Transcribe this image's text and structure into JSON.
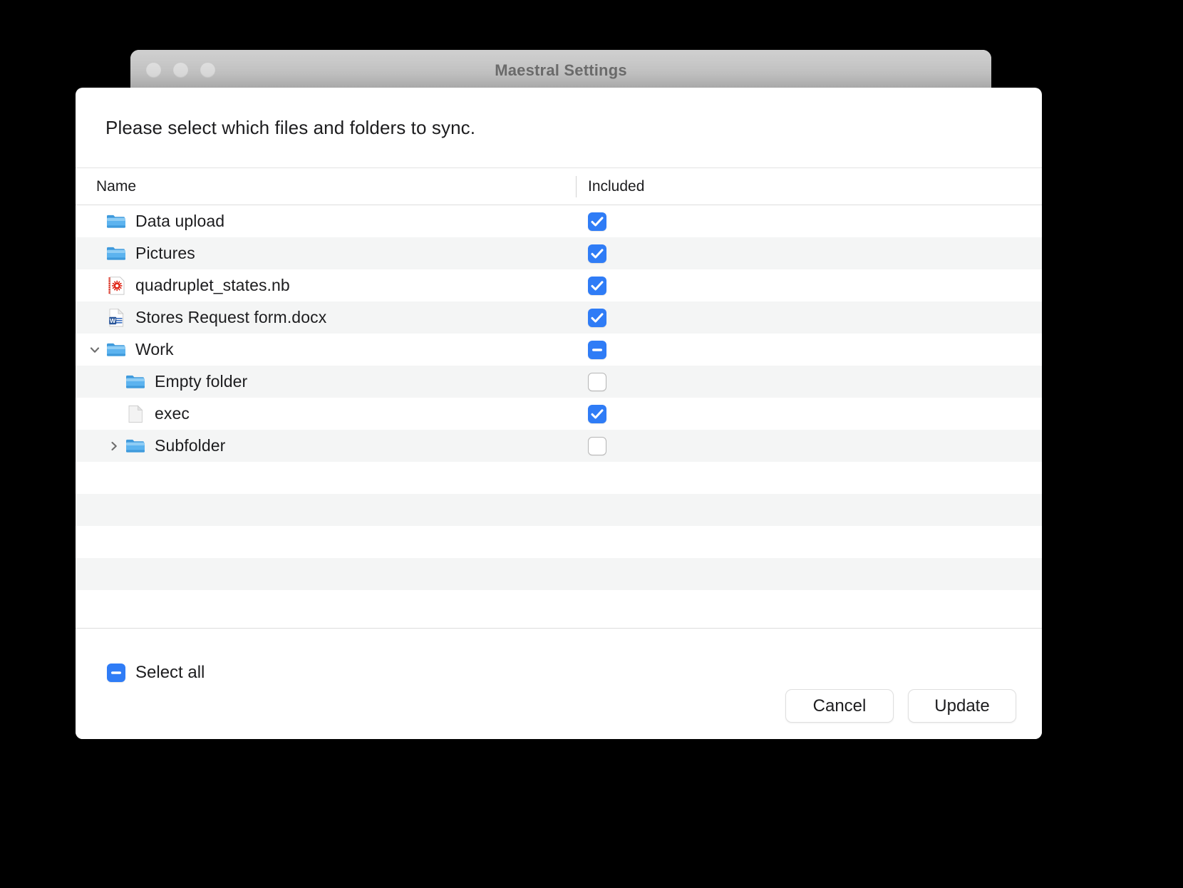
{
  "window": {
    "title": "Maestral Settings",
    "traffic_lights": [
      "close",
      "minimize",
      "zoom"
    ]
  },
  "dialog": {
    "prompt": "Please select which files and folders to sync.",
    "columns": {
      "name": "Name",
      "included": "Included"
    },
    "rows": [
      {
        "label": "Data upload",
        "icon": "folder-icon",
        "level": 0,
        "disclosure": "none",
        "checked": "on"
      },
      {
        "label": "Pictures",
        "icon": "folder-icon",
        "level": 0,
        "disclosure": "none",
        "checked": "on"
      },
      {
        "label": "quadruplet_states.nb",
        "icon": "mathematica-notebook-icon",
        "level": 0,
        "disclosure": "none",
        "checked": "on"
      },
      {
        "label": "Stores Request form.docx",
        "icon": "word-document-icon",
        "level": 0,
        "disclosure": "none",
        "checked": "on"
      },
      {
        "label": "Work",
        "icon": "folder-icon",
        "level": 0,
        "disclosure": "expanded",
        "checked": "mixed"
      },
      {
        "label": "Empty folder",
        "icon": "folder-icon",
        "level": 1,
        "disclosure": "none",
        "checked": "off"
      },
      {
        "label": "exec",
        "icon": "generic-file-icon",
        "level": 1,
        "disclosure": "none",
        "checked": "on"
      },
      {
        "label": "Subfolder",
        "icon": "folder-icon",
        "level": 1,
        "disclosure": "collapsed",
        "checked": "off"
      }
    ],
    "empty_row_count": 5,
    "select_all": {
      "label": "Select all",
      "checked": "mixed"
    },
    "buttons": {
      "cancel": "Cancel",
      "update": "Update"
    }
  },
  "colors": {
    "accent": "#2f7cf6",
    "folder_blue": "#5cb3ef",
    "folder_blue_dark": "#3f9adc",
    "word_blue": "#2a5699",
    "mathematica_red": "#dd1100",
    "row_alt": "#f4f5f5",
    "text": "#1d1d1f",
    "titlebar_text": "#6e6e6e"
  }
}
